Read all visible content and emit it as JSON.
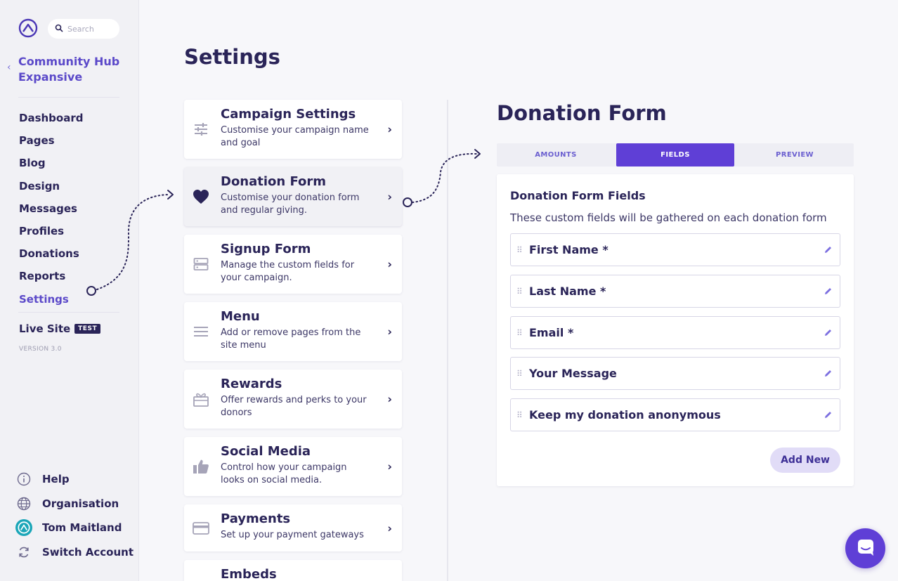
{
  "search": {
    "placeholder": "Search"
  },
  "org": {
    "name": "Community Hub Expansive"
  },
  "nav": [
    {
      "label": "Dashboard"
    },
    {
      "label": "Pages"
    },
    {
      "label": "Blog"
    },
    {
      "label": "Design"
    },
    {
      "label": "Messages"
    },
    {
      "label": "Profiles"
    },
    {
      "label": "Donations"
    },
    {
      "label": "Reports"
    },
    {
      "label": "Settings",
      "active": true
    }
  ],
  "live_site": {
    "label": "Live Site",
    "badge": "TEST",
    "version": "VERSION 3.0"
  },
  "bottom_nav": [
    {
      "label": "Help",
      "icon": "info-icon"
    },
    {
      "label": "Organisation",
      "icon": "globe-icon"
    },
    {
      "label": "Tom Maitland",
      "icon": "avatar"
    },
    {
      "label": "Switch Account",
      "icon": "switch-icon"
    }
  ],
  "page_title": "Settings",
  "settings_cards": [
    {
      "title": "Campaign Settings",
      "desc": "Customise your campaign name and goal",
      "icon": "sliders-icon"
    },
    {
      "title": "Donation Form",
      "desc": "Customise your donation form and regular giving.",
      "icon": "heart-icon",
      "selected": true
    },
    {
      "title": "Signup Form",
      "desc": "Manage the custom fields for your campaign.",
      "icon": "form-icon"
    },
    {
      "title": "Menu",
      "desc": "Add or remove pages from the site menu",
      "icon": "menu-icon"
    },
    {
      "title": "Rewards",
      "desc": "Offer rewards and perks to your donors",
      "icon": "gift-icon"
    },
    {
      "title": "Social Media",
      "desc": "Control how your campaign looks on social media.",
      "icon": "thumbs-up-icon"
    },
    {
      "title": "Payments",
      "desc": "Set up your payment gateways",
      "icon": "credit-card-icon"
    },
    {
      "title": "Embeds",
      "desc": "",
      "icon": ""
    }
  ],
  "panel": {
    "title": "Donation Form",
    "tabs": [
      {
        "label": "AMOUNTS"
      },
      {
        "label": "FIELDS",
        "active": true
      },
      {
        "label": "PREVIEW"
      }
    ],
    "fields_title": "Donation Form Fields",
    "fields_desc": "These custom fields will be gathered on each donation form",
    "fields": [
      {
        "label": "First Name *"
      },
      {
        "label": "Last Name *"
      },
      {
        "label": "Email *"
      },
      {
        "label": "Your Message"
      },
      {
        "label": "Keep my donation anonymous"
      }
    ],
    "add_new_label": "Add New"
  },
  "colors": {
    "brand": "#5f3fd6",
    "navy": "#2a2458",
    "accent_text": "#5b49c9"
  }
}
